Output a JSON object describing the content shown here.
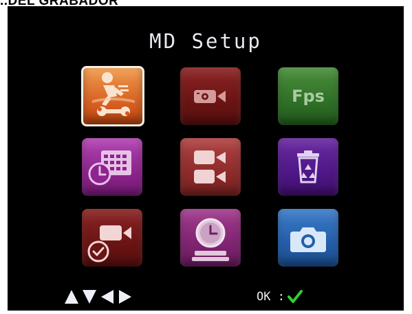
{
  "page_header": {
    "text": "..DEL GRABADOR"
  },
  "screen": {
    "title": "MD Setup",
    "menu": [
      {
        "icon": "motion-detect-settings-icon",
        "selected": true
      },
      {
        "icon": "video-camera-icon"
      },
      {
        "icon": "fps-icon",
        "label": "Fps"
      },
      {
        "icon": "schedule-calendar-clock-icon"
      },
      {
        "icon": "dual-camera-icon"
      },
      {
        "icon": "recycle-bin-icon"
      },
      {
        "icon": "camera-record-check-icon"
      },
      {
        "icon": "clock-stand-icon"
      },
      {
        "icon": "photo-camera-icon"
      }
    ],
    "footer": {
      "nav_icons": [
        "arrow-up-icon",
        "arrow-down-icon",
        "arrow-left-icon",
        "arrow-right-icon"
      ],
      "ok_label": "OK :",
      "ok_icon": "checkmark-icon"
    }
  },
  "colors": {
    "screen_bg": "#000000",
    "selected_tile": "#d4591e",
    "check_green": "#2fd12f"
  }
}
